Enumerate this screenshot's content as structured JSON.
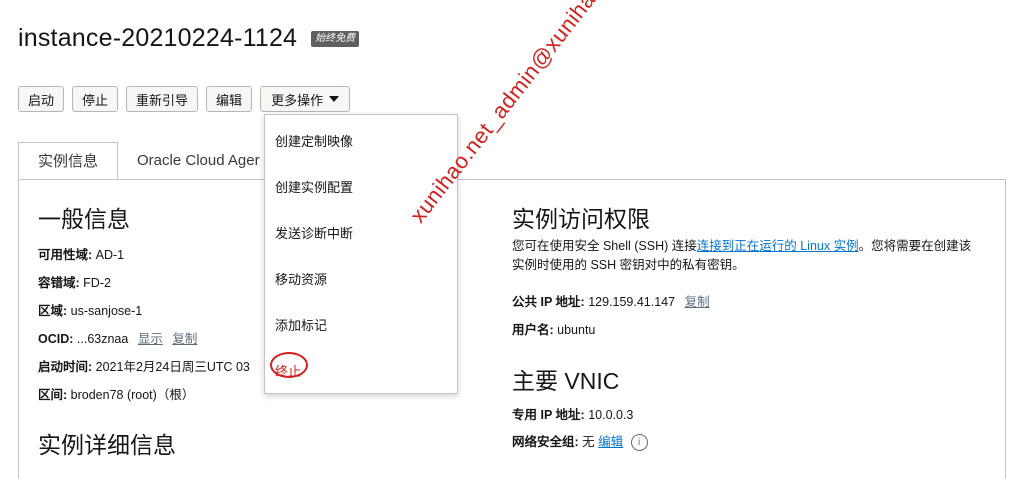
{
  "header": {
    "title": "instance-20210224-1124",
    "badge": "始终免费"
  },
  "toolbar": {
    "start": "启动",
    "stop": "停止",
    "reboot": "重新引导",
    "edit": "编辑",
    "more": "更多操作"
  },
  "tabs": [
    {
      "label": "实例信息"
    },
    {
      "label": "Oracle Cloud Ager"
    }
  ],
  "general": {
    "heading": "一般信息",
    "availability_domain": {
      "label": "可用性域:",
      "value": "AD-1"
    },
    "fault_domain": {
      "label": "容错域:",
      "value": "FD-2"
    },
    "region": {
      "label": "区域:",
      "value": "us-sanjose-1"
    },
    "ocid": {
      "label": "OCID:",
      "value": "...63znaa",
      "show": "显示",
      "copy": "复制"
    },
    "launched": {
      "label": "启动时间:",
      "value": "2021年2月24日周三UTC 03"
    },
    "compartment": {
      "label": "区间:",
      "value": "broden78 (root)（根）"
    }
  },
  "details_heading": "实例详细信息",
  "access": {
    "heading": "实例访问权限",
    "desc_prefix": "您可在使用安全 Shell (SSH) 连接",
    "desc_link": "连接到正在运行的 Linux 实例",
    "desc_suffix": "。您将需要在创建该实例时使用的 SSH 密钥对中的私有密钥。",
    "public_ip": {
      "label": "公共 IP 地址:",
      "value": "129.159.41.147",
      "copy": "复制"
    },
    "username": {
      "label": "用户名:",
      "value": "ubuntu"
    }
  },
  "vnic": {
    "heading": "主要 VNIC",
    "private_ip": {
      "label": "专用 IP 地址:",
      "value": "10.0.0.3"
    },
    "nsg": {
      "label": "网络安全组:",
      "value": "无",
      "edit": "编辑"
    }
  },
  "menu": {
    "items": [
      {
        "label": "创建定制映像"
      },
      {
        "label": "创建实例配置"
      },
      {
        "label": "发送诊断中断"
      },
      {
        "label": "移动资源"
      },
      {
        "label": "添加标记"
      },
      {
        "label": "终止"
      }
    ]
  },
  "watermark": "xunihao.net_admin@xunihao.net",
  "colors": {
    "link": "#0572ce",
    "annotation": "#d0221f",
    "badge": "#5f5f5f"
  }
}
